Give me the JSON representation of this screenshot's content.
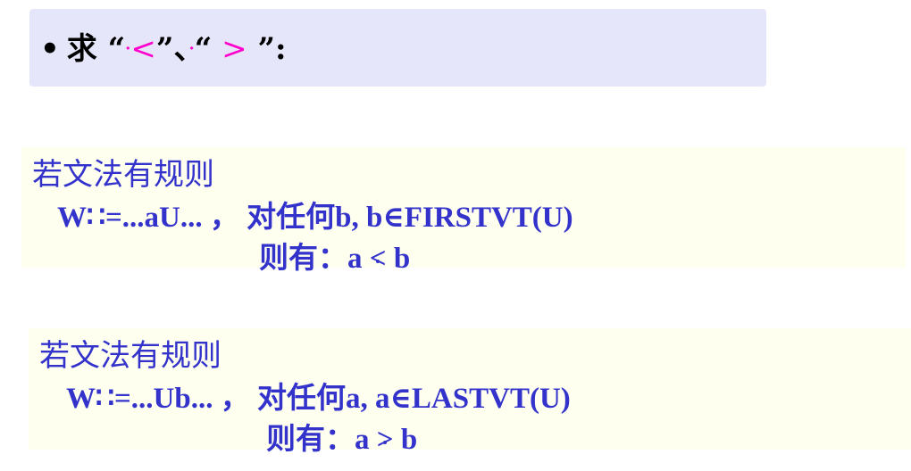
{
  "header": {
    "bullet": "•",
    "prefix": "求 ",
    "open_quote_1": "“",
    "dot_1": "·",
    "less_symbol": "<",
    "close_quote_1": "”、",
    "dot_2": "·",
    "open_quote_2": "“",
    "greater_symbol": " >",
    "close_quote_2": " ”:"
  },
  "rule1": {
    "title": "若文法有规则",
    "production": "W∷=...aU... ， 对任何b, b∈FIRSTVT(U)",
    "result_prefix": "则有：a ",
    "relation": "<",
    "result_suffix": " b"
  },
  "rule2": {
    "title": "若文法有规则",
    "production": "W∷=...Ub... ， 对任何a, a∈LASTVT(U)",
    "result_prefix": "则有：a ",
    "relation": ">",
    "result_suffix": " b"
  },
  "colors": {
    "header_bg": "#e6e6fa",
    "rule_bg": "#fffff0",
    "rule_text": "#3333cc",
    "highlight": "#ff00cc"
  }
}
